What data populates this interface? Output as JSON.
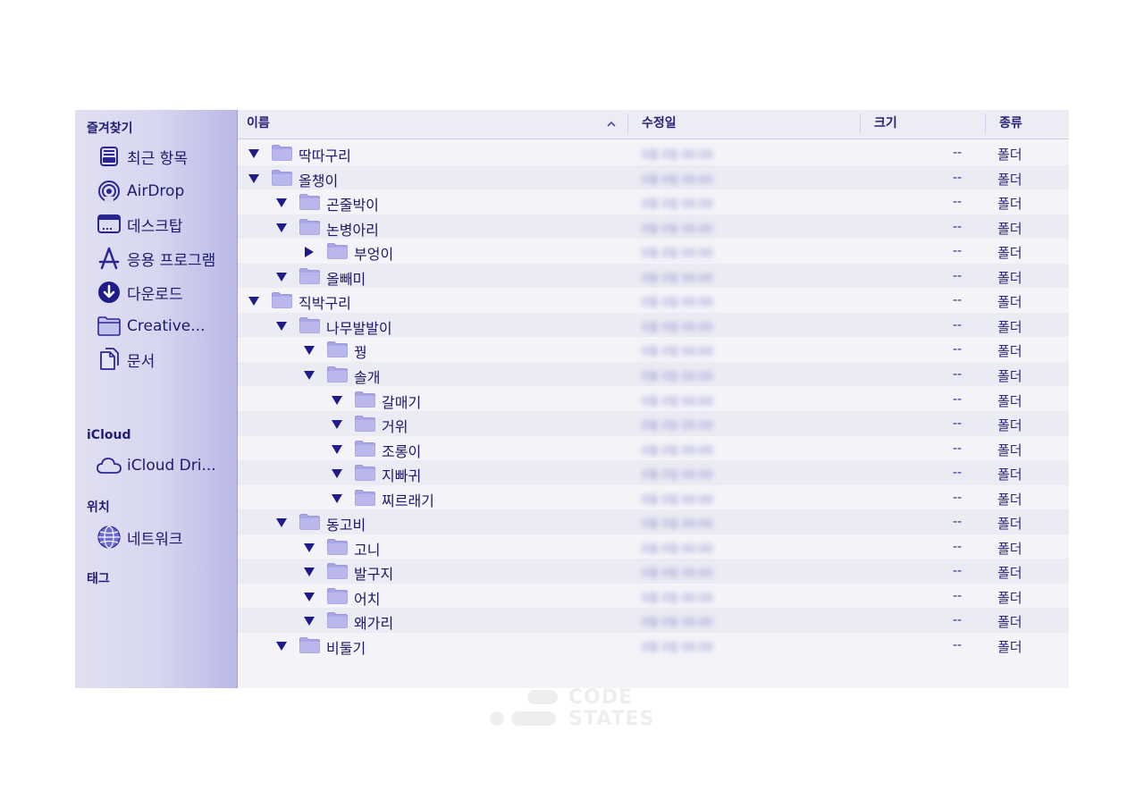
{
  "sidebar": {
    "favorites_heading": "즐겨찾기",
    "favorites": [
      {
        "label": "최근 항목",
        "icon": "recents-icon"
      },
      {
        "label": "AirDrop",
        "icon": "airdrop-icon"
      },
      {
        "label": "데스크탑",
        "icon": "desktop-icon"
      },
      {
        "label": "응용 프로그램",
        "icon": "applications-icon"
      },
      {
        "label": "다운로드",
        "icon": "downloads-icon"
      },
      {
        "label": "Creative...",
        "icon": "folder-icon"
      },
      {
        "label": "문서",
        "icon": "documents-icon"
      }
    ],
    "icloud_heading": "iCloud",
    "icloud": [
      {
        "label": "iCloud Dri...",
        "icon": "cloud-icon"
      }
    ],
    "locations_heading": "위치",
    "locations": [
      {
        "label": "네트워크",
        "icon": "network-icon"
      }
    ],
    "tags_heading": "태그"
  },
  "columns": {
    "name": "이름",
    "modified": "수정일",
    "size": "크기",
    "kind": "종류"
  },
  "sort_icon": "chevron-up-icon",
  "blurred_date": "0월 0일 00:00",
  "rows": [
    {
      "name": "딱따구리",
      "depth": 0,
      "expanded": true,
      "size": "--",
      "kind": "폴더"
    },
    {
      "name": "올챙이",
      "depth": 0,
      "expanded": true,
      "size": "--",
      "kind": "폴더"
    },
    {
      "name": "곤줄박이",
      "depth": 1,
      "expanded": true,
      "size": "--",
      "kind": "폴더"
    },
    {
      "name": "논병아리",
      "depth": 1,
      "expanded": true,
      "size": "--",
      "kind": "폴더"
    },
    {
      "name": "부엉이",
      "depth": 2,
      "expanded": false,
      "size": "--",
      "kind": "폴더"
    },
    {
      "name": "올빼미",
      "depth": 1,
      "expanded": true,
      "size": "--",
      "kind": "폴더"
    },
    {
      "name": "직박구리",
      "depth": 0,
      "expanded": true,
      "size": "--",
      "kind": "폴더"
    },
    {
      "name": "나무발발이",
      "depth": 1,
      "expanded": true,
      "size": "--",
      "kind": "폴더"
    },
    {
      "name": "꿩",
      "depth": 2,
      "expanded": true,
      "size": "--",
      "kind": "폴더"
    },
    {
      "name": "솔개",
      "depth": 2,
      "expanded": true,
      "size": "--",
      "kind": "폴더"
    },
    {
      "name": "갈매기",
      "depth": 3,
      "expanded": true,
      "size": "--",
      "kind": "폴더"
    },
    {
      "name": "거위",
      "depth": 3,
      "expanded": true,
      "size": "--",
      "kind": "폴더"
    },
    {
      "name": "조롱이",
      "depth": 3,
      "expanded": true,
      "size": "--",
      "kind": "폴더"
    },
    {
      "name": "지빠귀",
      "depth": 3,
      "expanded": true,
      "size": "--",
      "kind": "폴더"
    },
    {
      "name": "찌르래기",
      "depth": 3,
      "expanded": true,
      "size": "--",
      "kind": "폴더"
    },
    {
      "name": "동고비",
      "depth": 1,
      "expanded": true,
      "size": "--",
      "kind": "폴더"
    },
    {
      "name": "고니",
      "depth": 2,
      "expanded": true,
      "size": "--",
      "kind": "폴더"
    },
    {
      "name": "발구지",
      "depth": 2,
      "expanded": true,
      "size": "--",
      "kind": "폴더"
    },
    {
      "name": "어치",
      "depth": 2,
      "expanded": true,
      "size": "--",
      "kind": "폴더"
    },
    {
      "name": "왜가리",
      "depth": 2,
      "expanded": true,
      "size": "--",
      "kind": "폴더"
    },
    {
      "name": "비둘기",
      "depth": 1,
      "expanded": true,
      "size": "--",
      "kind": "폴더"
    }
  ],
  "watermark": {
    "line1": "CODE",
    "line2": "STATES"
  },
  "colors": {
    "accent": "#3b38b8",
    "folder": "#a8a6e6",
    "sidebar_edge": "#bab8e7"
  }
}
